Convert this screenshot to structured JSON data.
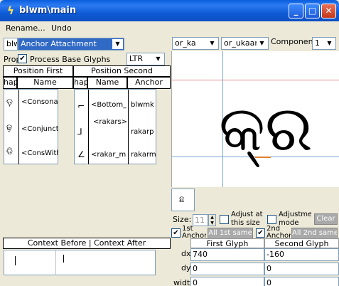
{
  "window": {
    "title": "blwm\\main",
    "minimize": "_",
    "maximize": "□",
    "close": "✕"
  },
  "menu": {
    "rename": "Rename...",
    "undo": "Undo"
  },
  "left": {
    "lookup_small": "blw",
    "lookup_type": "Anchor Attachment",
    "prop_label": "Prop",
    "process_base_glyphs": "Process Base Glyphs",
    "process_base_glyphs_checked": true,
    "direction": "LTR",
    "position_first": {
      "header": "Position First",
      "col_shape": "hap",
      "col_name": "Name",
      "rows": [
        {
          "glyph": "ଡ଼",
          "name": "<Consonar"
        },
        {
          "glyph": "ଢ଼",
          "name": "<Conjuncts"
        },
        {
          "glyph": "ଡି",
          "name": "<ConsWith"
        }
      ]
    },
    "position_second": {
      "header": "Position Second",
      "col_shape": "hap",
      "col_name": "Name",
      "col_anchor": "Anchor",
      "rows": [
        {
          "glyph": "⌐",
          "name": "<Bottom_M",
          "anchor": "blwmk"
        },
        {
          "glyph": "⅃",
          "name": "<rakars>",
          "anchor": "rakarp"
        },
        {
          "glyph": "∠",
          "name": "<rakar_ma",
          "anchor": "rakarm"
        }
      ]
    },
    "context_header": "Context Before | Context After"
  },
  "right": {
    "glyph1": "or_ka",
    "glyph2": "or_ukaar",
    "component_label": "Component:",
    "component_value": "1",
    "preview_glyph": "କ୍ର",
    "thumb_glyph": "ଛ",
    "size_label": "Size:",
    "size_value": "11",
    "adjust_at_size": "Adjust at this size",
    "adjust_mode": "Adjustment mode",
    "clear": "Clear",
    "first_anchor": "1st Anchor",
    "first_anchor_checked": true,
    "all_first_same": "All 1st same",
    "second_anchor": "2nd Anchor",
    "second_anchor_checked": true,
    "all_second_same": "All 2nd same",
    "table": {
      "col_first": "First Glyph",
      "col_second": "Second Glyph",
      "rows": [
        {
          "label": "dx",
          "first": "740",
          "second": "-160"
        },
        {
          "label": "dy",
          "first": "0",
          "second": "0"
        },
        {
          "label": "width",
          "first": "0",
          "second": "0"
        }
      ]
    }
  },
  "colors": {
    "title_blue": "#0A5FDD",
    "border_blue": "#7F9DB9",
    "guide_red": "#E58C8C",
    "guide_blue": "#7BA7D9",
    "anchor_orange": "#E08030"
  }
}
